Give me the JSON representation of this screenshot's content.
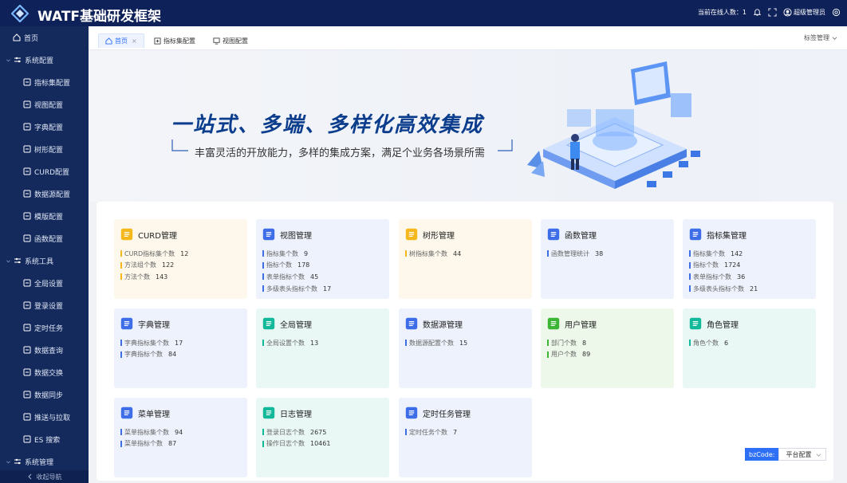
{
  "header": {
    "title": "WATF基础研发框架",
    "online_label": "当前在线人数：",
    "online_count": "1",
    "user": "超级管理员"
  },
  "sidebar": {
    "home": "首页",
    "groups": [
      {
        "label": "系统配置",
        "items": [
          "指标集配置",
          "视图配置",
          "字典配置",
          "树形配置",
          "CURD配置",
          "数据源配置",
          "模版配置",
          "函数配置"
        ]
      },
      {
        "label": "系统工具",
        "items": [
          "全局设置",
          "登录设置",
          "定时任务",
          "数据查询",
          "数据交换",
          "数据同步",
          "推送与拉取",
          "ES 搜索"
        ]
      },
      {
        "label": "系统管理",
        "items": []
      }
    ],
    "collapse": "收起导航"
  },
  "tabs": {
    "items": [
      "首页",
      "指标集配置",
      "视图配置"
    ],
    "menu": "标签管理"
  },
  "banner": {
    "title": "一站式、多端、多样化高效集成",
    "subtitle": "丰富灵活的开放能力，多样的集成方案，满足个业务各场景所需"
  },
  "cards": [
    {
      "title": "CURD管理",
      "icon": "curd-icon",
      "bg": "#fdf8eb",
      "accent": "#f5b81c",
      "stats": [
        {
          "label": "CURD指标集个数",
          "value": "12"
        },
        {
          "label": "方法组个数",
          "value": "122"
        },
        {
          "label": "方法个数",
          "value": "143"
        }
      ]
    },
    {
      "title": "视图管理",
      "icon": "view-icon",
      "bg": "#eef2fc",
      "accent": "#3d6ee8",
      "stats": [
        {
          "label": "指标集个数",
          "value": "9"
        },
        {
          "label": "指标个数",
          "value": "178"
        },
        {
          "label": "表单指标个数",
          "value": "45"
        },
        {
          "label": "多级表头指标个数",
          "value": "17"
        }
      ]
    },
    {
      "title": "树形管理",
      "icon": "tree-icon",
      "bg": "#fdf8eb",
      "accent": "#f5b81c",
      "stats": [
        {
          "label": "树指标集个数",
          "value": "44"
        }
      ]
    },
    {
      "title": "函数管理",
      "icon": "function-icon",
      "bg": "#eef2fc",
      "accent": "#3d6ee8",
      "stats": [
        {
          "label": "函数管理统计",
          "value": "38"
        }
      ]
    },
    {
      "title": "指标集管理",
      "icon": "indicator-set-icon",
      "bg": "#eef2fc",
      "accent": "#3d6ee8",
      "stats": [
        {
          "label": "指标集个数",
          "value": "142"
        },
        {
          "label": "指标个数",
          "value": "1724"
        },
        {
          "label": "表单指标个数",
          "value": "36"
        },
        {
          "label": "多级表头指标个数",
          "value": "21"
        }
      ]
    },
    {
      "title": "字典管理",
      "icon": "dictionary-icon",
      "bg": "#eef2fc",
      "accent": "#3d6ee8",
      "stats": [
        {
          "label": "字典指标集个数",
          "value": "17"
        },
        {
          "label": "字典指标个数",
          "value": "84"
        }
      ]
    },
    {
      "title": "全局管理",
      "icon": "global-icon",
      "bg": "#e9f8f4",
      "accent": "#12b89a",
      "stats": [
        {
          "label": "全局设置个数",
          "value": "13"
        }
      ]
    },
    {
      "title": "数据源管理",
      "icon": "datasource-icon",
      "bg": "#eef2fc",
      "accent": "#3d6ee8",
      "stats": [
        {
          "label": "数据源配置个数",
          "value": "15"
        }
      ]
    },
    {
      "title": "用户管理",
      "icon": "user-icon",
      "bg": "#edf8ea",
      "accent": "#3cb534",
      "stats": [
        {
          "label": "部门个数",
          "value": "8"
        },
        {
          "label": "用户个数",
          "value": "89"
        }
      ]
    },
    {
      "title": "角色管理",
      "icon": "role-icon",
      "bg": "#e9f8f4",
      "accent": "#12b89a",
      "stats": [
        {
          "label": "角色个数",
          "value": "6"
        }
      ]
    },
    {
      "title": "菜单管理",
      "icon": "menu-icon",
      "bg": "#eef2fc",
      "accent": "#3d6ee8",
      "stats": [
        {
          "label": "菜单指标集个数",
          "value": "94"
        },
        {
          "label": "菜单指标个数",
          "value": "87"
        }
      ]
    },
    {
      "title": "日志管理",
      "icon": "log-icon",
      "bg": "#e9f8f4",
      "accent": "#12b89a",
      "stats": [
        {
          "label": "登录日志个数",
          "value": "2675"
        },
        {
          "label": "操作日志个数",
          "value": "10461"
        }
      ]
    },
    {
      "title": "定时任务管理",
      "icon": "scheduled-task-icon",
      "bg": "#eef2fc",
      "accent": "#3d6ee8",
      "stats": [
        {
          "label": "定时任务个数",
          "value": "7"
        }
      ]
    }
  ],
  "bz": {
    "label": "bzCode:",
    "value": "平台配置"
  }
}
